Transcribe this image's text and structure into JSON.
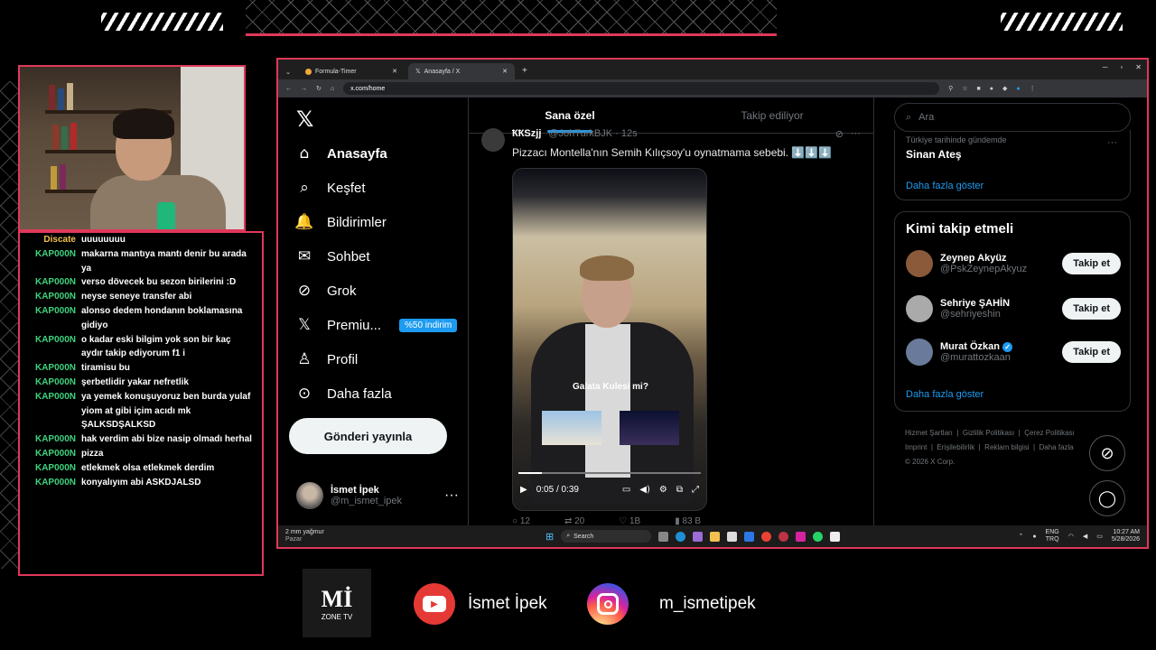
{
  "chat": {
    "messages": [
      {
        "user": "Discate",
        "text": "uuuuuuuu"
      },
      {
        "user": "KAP000N",
        "text": "makarna mantıya mantı denir bu arada ya"
      },
      {
        "user": "KAP000N",
        "text": "verso dövecek bu sezon birilerini :D"
      },
      {
        "user": "KAP000N",
        "text": "neyse seneye transfer abi"
      },
      {
        "user": "KAP000N",
        "text": "alonso dedem hondanın boklamasına gidiyo"
      },
      {
        "user": "KAP000N",
        "text": "o kadar eski bilgim yok son bir kaç aydır takip ediyorum f1 i"
      },
      {
        "user": "KAP000N",
        "text": "tiramisu bu"
      },
      {
        "user": "KAP000N",
        "text": "şerbetlidir yakar nefretlik"
      },
      {
        "user": "KAP000N",
        "text": "ya yemek konuşuyoruz ben burda yulaf yiom at gibi içim acıdı mk ŞALKSDŞALKSD"
      },
      {
        "user": "KAP000N",
        "text": "hak verdim abi bize nasip olmadı herhal"
      },
      {
        "user": "KAP000N",
        "text": "pizza"
      },
      {
        "user": "KAP000N",
        "text": "etlekmek olsa etlekmek derdim"
      },
      {
        "user": "KAP000N",
        "text": "konyalıyım abi ASKDJALSD"
      }
    ]
  },
  "browser": {
    "tabs": [
      {
        "label": "Formula-Timer"
      },
      {
        "label": "Anasayfa / X"
      }
    ],
    "new_tab": "+",
    "url": "x.com/home"
  },
  "x": {
    "logo": "𝕏",
    "nav": [
      {
        "label": "Anasayfa",
        "icon": "home-icon",
        "glyph": "⌂"
      },
      {
        "label": "Keşfet",
        "icon": "search-icon",
        "glyph": "⌕"
      },
      {
        "label": "Bildirimler",
        "icon": "bell-icon",
        "glyph": "🔔"
      },
      {
        "label": "Sohbet",
        "icon": "mail-icon",
        "glyph": "✉"
      },
      {
        "label": "Grok",
        "icon": "grok-icon",
        "glyph": "⊘"
      },
      {
        "label": "Premiu...",
        "icon": "x-premium-icon",
        "glyph": "𝕏"
      },
      {
        "label": "Profil",
        "icon": "person-icon",
        "glyph": "♙"
      },
      {
        "label": "Daha fazla",
        "icon": "more-circle-icon",
        "glyph": "⊙"
      }
    ],
    "premium_badge": "%50 indirim",
    "post_button": "Gönderi yayınla",
    "profile": {
      "name": "İsmet İpek",
      "handle": "@m_ismet_ipek",
      "more": "···"
    },
    "feed_tabs": [
      "Sana özel",
      "Takip ediliyor"
    ],
    "tweet": {
      "author": "ҞҞSzjj",
      "handle": "@JohTurkBJK · 12s",
      "text": "Pizzacı Montella'nın Semih Kılıçsoy'u oynatmama sebebi. ⬇️⬇️⬇️",
      "caption": "Galata Kulesi mi?",
      "time": "0:05 / 0:39",
      "progress": 0.13,
      "actions": [
        "12",
        "20",
        "1B",
        "83 B"
      ]
    },
    "search_placeholder": "Ara",
    "trend": {
      "context": "Türkiye tarihinde gündemde",
      "name": "Sinan Ateş",
      "more": "Daha fazla göster"
    },
    "who_to_follow": {
      "title": "Kimi takip etmeli",
      "users": [
        {
          "name": "Zeynep Akyüz",
          "handle": "@PskZeynepAkyuz",
          "button": "Takip et",
          "verified": false
        },
        {
          "name": "Sehriye ŞAHİN",
          "handle": "@sehriyeshin",
          "button": "Takip et",
          "verified": false
        },
        {
          "name": "Murat Özkan",
          "handle": "@murattozkaan",
          "button": "Takip et",
          "verified": true
        }
      ],
      "more": "Daha fazla göster"
    },
    "footer": [
      "Hizmet Şartları",
      "Gizlilik Politikası",
      "Çerez Politikası",
      "Imprint",
      "Erişilebilirlik",
      "Reklam bilgisi",
      "Daha fazla",
      "© 2026 X Corp."
    ]
  },
  "taskbar": {
    "weather": "2 mm yağmur",
    "weather_sub": "Pazar",
    "search": "Search",
    "lang": "ENG",
    "lang_sub": "TRQ",
    "time": "10:27 AM",
    "date": "5/28/2026"
  },
  "socials": {
    "youtube": "İsmet İpek",
    "instagram": "m_ismetipek",
    "logo_big": "Mİ",
    "logo_small": "ZONE TV"
  }
}
